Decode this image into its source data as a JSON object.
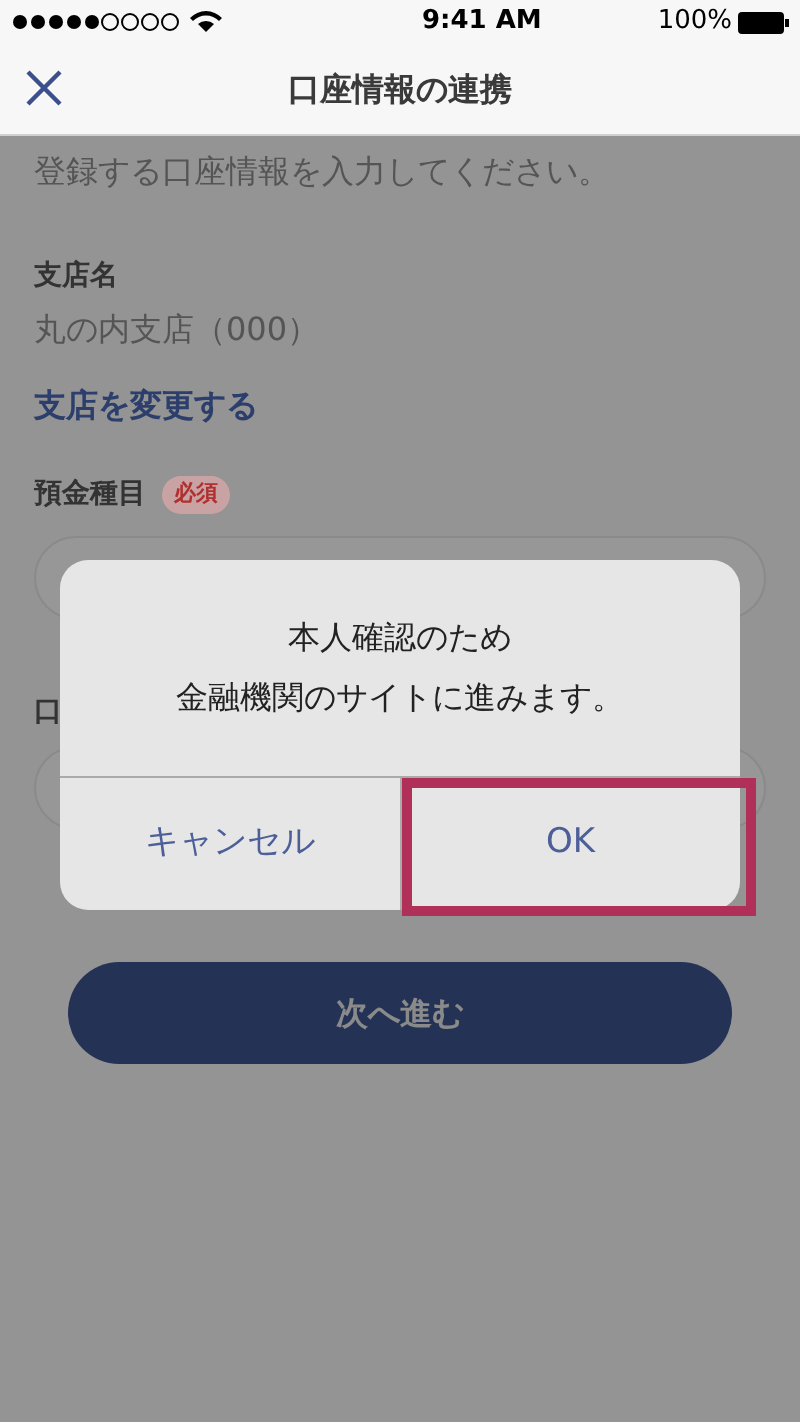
{
  "status_bar": {
    "time": "9:41 AM",
    "battery": "100%"
  },
  "nav": {
    "title": "口座情報の連携"
  },
  "form": {
    "intro": "登録する口座情報を入力してください。",
    "branch_label": "支店名",
    "branch_value": "丸の内支店（000）",
    "change_link": "支店を変更する",
    "deposit_label": "預金種目",
    "required_badge": "必須",
    "account_label": "口"
  },
  "next_button": "次へ進む",
  "dialog": {
    "message": [
      "本人確認のため",
      "金融機関のサイトに進みます。"
    ],
    "buttons": [
      {
        "label": "キャンセル",
        "highlighted": false
      },
      {
        "label": "OK",
        "highlighted": true
      }
    ]
  }
}
